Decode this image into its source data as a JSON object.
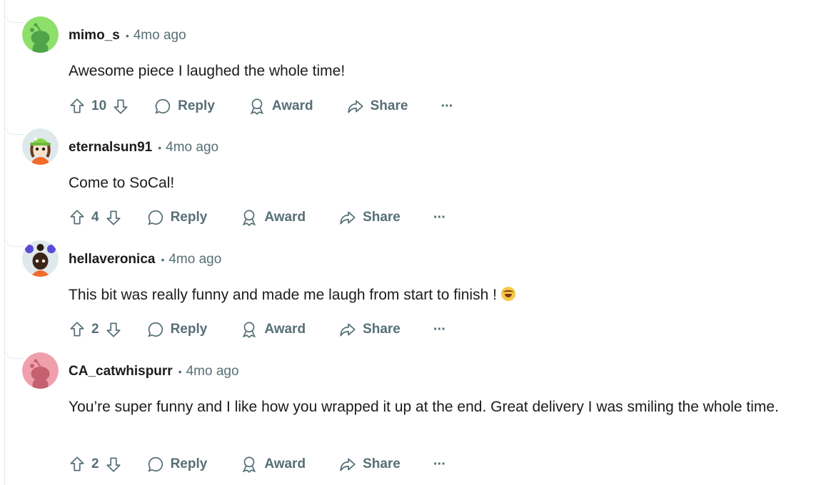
{
  "colors": {
    "text": "#1c1c1c",
    "muted": "#576f76",
    "thread_line": "#e5ebee"
  },
  "comments": [
    {
      "author": "mimo_s",
      "time": "4mo ago",
      "body": "Awesome piece I laughed the whole time!",
      "score": "10",
      "reply": "Reply",
      "award": "Award",
      "share": "Share",
      "more": "···",
      "avatar_color": "#8ee06b"
    },
    {
      "author": "eternalsun91",
      "time": "4mo ago",
      "body": "Come to SoCal!",
      "score": "4",
      "reply": "Reply",
      "award": "Award",
      "share": "Share",
      "more": "···",
      "avatar_color": "#dfe9ec"
    },
    {
      "author": "hellaveronica",
      "time": "4mo ago",
      "body": "This bit was really funny and made me laugh from start to finish !",
      "emoji": "laughing-tears-emoji",
      "score": "2",
      "reply": "Reply",
      "award": "Award",
      "share": "Share",
      "more": "···",
      "avatar_color": "#dfe9ec"
    },
    {
      "author": "CA_catwhispurr",
      "time": "4mo ago",
      "body": "You’re super funny and I like how you wrapped it up at the end. Great delivery I was smiling the whole time.",
      "score": "2",
      "reply": "Reply",
      "award": "Award",
      "share": "Share",
      "more": "···",
      "avatar_color": "#f0a0ad"
    }
  ]
}
